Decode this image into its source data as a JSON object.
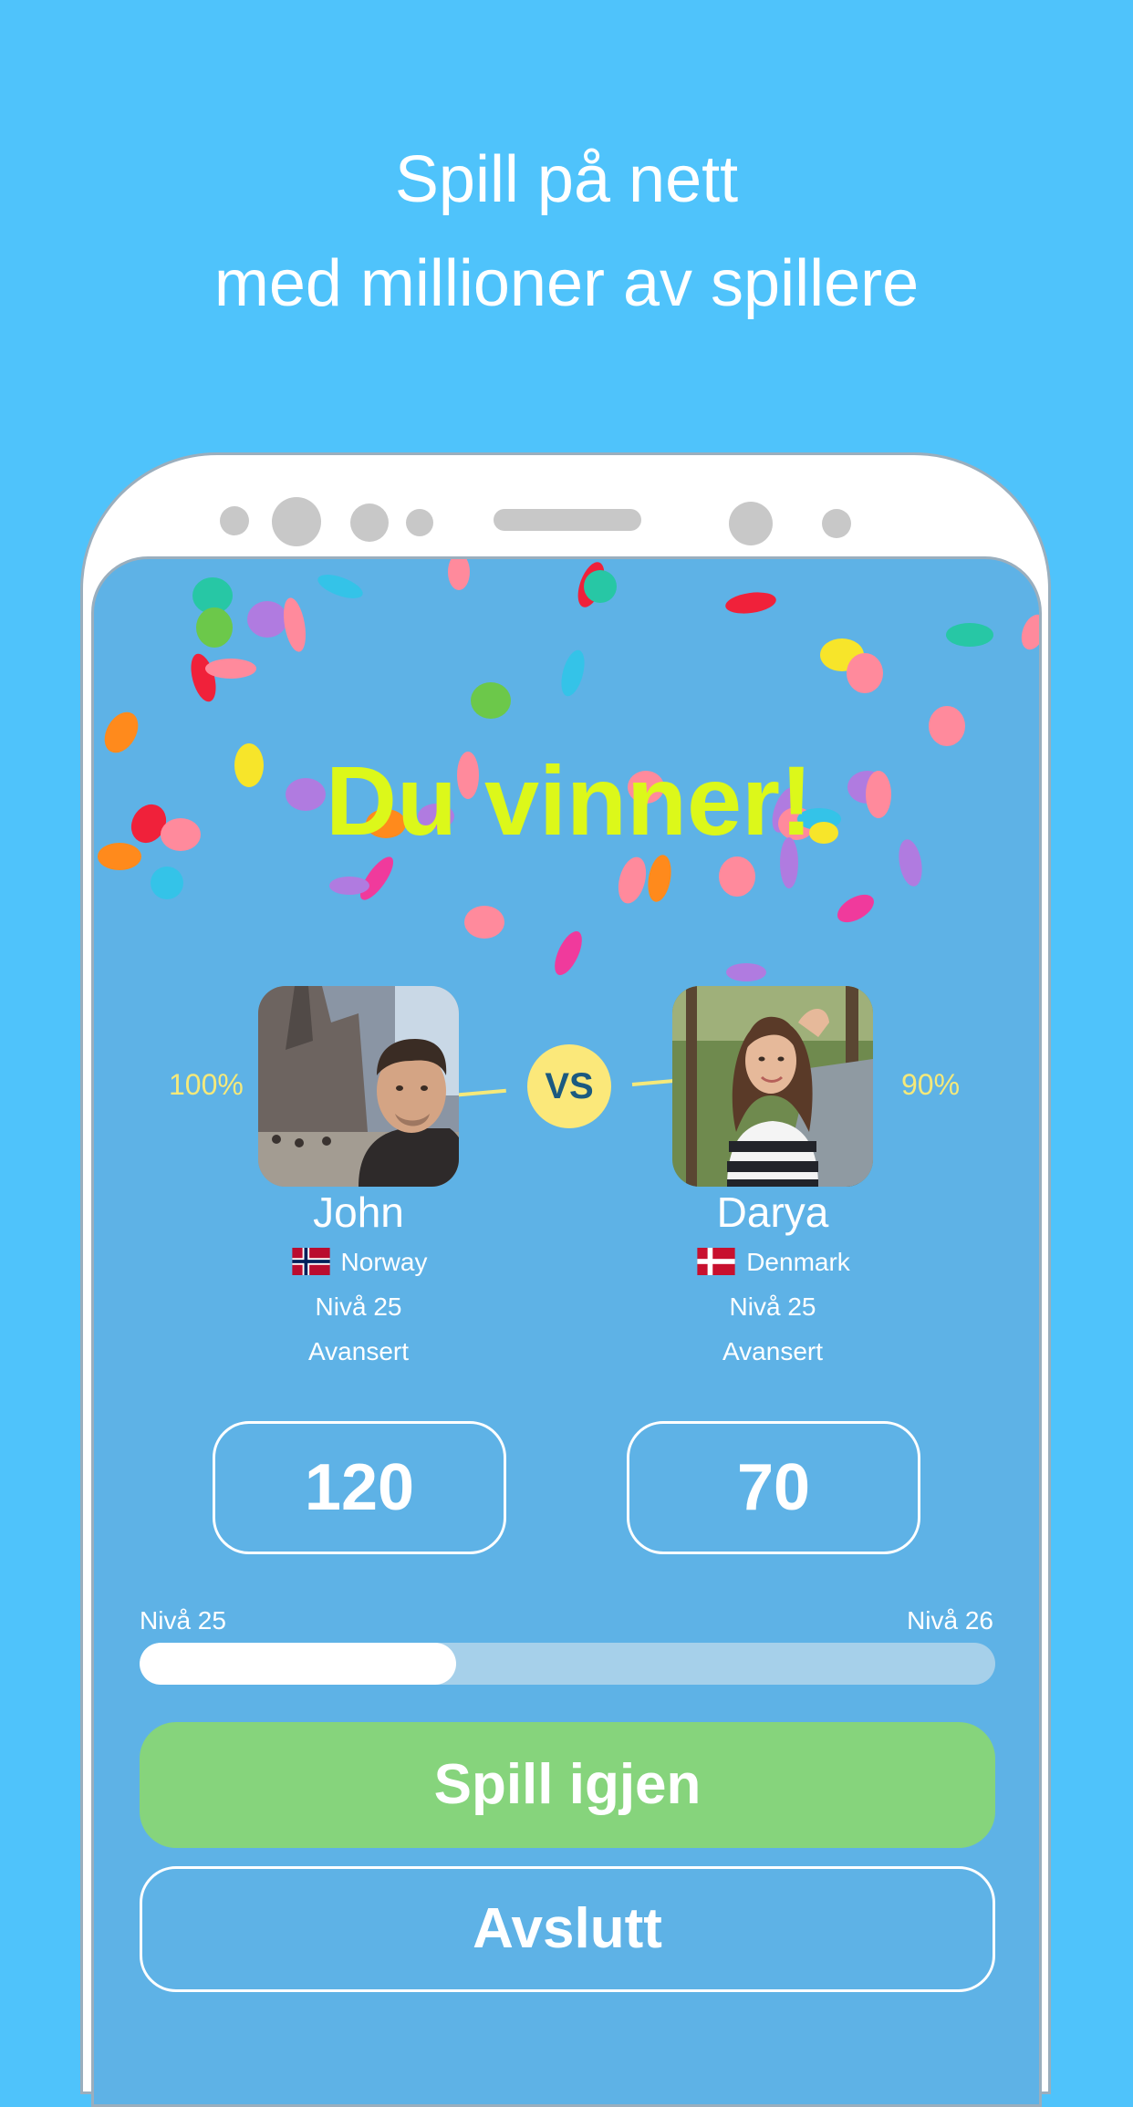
{
  "headline": {
    "line1": "Spill på nett",
    "line2": "med millioner av spillere"
  },
  "result": {
    "title": "Du vinner!"
  },
  "versus": {
    "label": "VS",
    "left_percent": "100%",
    "right_percent": "90%"
  },
  "player1": {
    "name": "John",
    "country": "Norway",
    "level": "Nivå 25",
    "rank": "Avansert",
    "score": "120"
  },
  "player2": {
    "name": "Darya",
    "country": "Denmark",
    "level": "Nivå 25",
    "rank": "Avansert",
    "score": "70"
  },
  "progress": {
    "current_level": "Nivå 25",
    "next_level": "Nivå 26",
    "fraction": 0.37
  },
  "buttons": {
    "play_again": "Spill igjen",
    "quit": "Avslutt"
  },
  "colors": {
    "page_background": "#4fc3fb",
    "screen_background": "#5eb2e6",
    "win_title": "#dcf81a",
    "play_button": "#86d47c",
    "accent_yellow": "#f5e97a"
  }
}
